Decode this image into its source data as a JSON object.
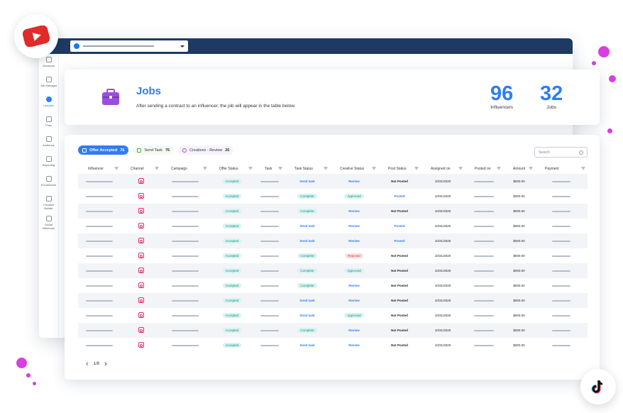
{
  "colors": {
    "accent": "#2f7df6",
    "titlebar": "#1e3a63",
    "decor_dots": "#d83ee0",
    "pill_teal": "#d6f4f1",
    "pill_red": "#fde1e1"
  },
  "badges": {
    "top_left": "youtube-logo",
    "bottom_right": "tiktok-logo"
  },
  "sidebar": {
    "items": [
      {
        "label": "Accounts",
        "icon": "person-icon"
      },
      {
        "label": "Job Manager",
        "icon": "briefcase-icon"
      },
      {
        "label": "Updates",
        "icon": "updates-icon",
        "active": true
      },
      {
        "label": "Flow",
        "icon": "flow-icon"
      },
      {
        "label": "Audience",
        "icon": "audience-icon"
      },
      {
        "label": "Reporting",
        "icon": "reporting-icon"
      },
      {
        "label": "Ecommerce",
        "icon": "cart-icon"
      },
      {
        "label": "Creative Builder",
        "icon": "builder-icon"
      },
      {
        "label": "Social Influencer",
        "icon": "influencer-icon"
      }
    ]
  },
  "header": {
    "title": "Jobs",
    "subtitle": "After sending a contract to an influencer, the job will appear in the table below.",
    "stats": [
      {
        "value": "96",
        "label": "Influencers"
      },
      {
        "value": "32",
        "label": "Jobs"
      }
    ]
  },
  "tabs": [
    {
      "label": "Offer Accepted",
      "count": "76"
    },
    {
      "label": "Send Task",
      "count": "76"
    },
    {
      "label": "Creatives - Review",
      "count": "26"
    }
  ],
  "search": {
    "placeholder": "Search"
  },
  "table": {
    "columns": [
      "Influencer",
      "Channel",
      "Campaign",
      "Offer Status",
      "Task",
      "Task Status",
      "Creative Status",
      "Post Status",
      "Assigned on",
      "Posted on",
      "Amount",
      "Payment"
    ],
    "rows": [
      {
        "offer": "Accepted",
        "task_status": "Send task",
        "creative": "Review",
        "post": "Not Posted",
        "assigned": "10/31/2020",
        "amount": "$000.00"
      },
      {
        "offer": "Accepted",
        "task_status": "Complete",
        "creative": "Approved",
        "post": "Posted",
        "assigned": "10/31/2020",
        "amount": "$000.00"
      },
      {
        "offer": "Accepted",
        "task_status": "Complete",
        "creative": "Review",
        "post": "Not Posted",
        "assigned": "10/31/2020",
        "amount": "$000.00"
      },
      {
        "offer": "Accepted",
        "task_status": "Send task",
        "creative": "Review",
        "post": "Posted",
        "assigned": "10/31/2020",
        "amount": "$000.00"
      },
      {
        "offer": "Accepted",
        "task_status": "Send task",
        "creative": "Review",
        "post": "Posted",
        "assigned": "10/31/2020",
        "amount": "$000.00"
      },
      {
        "offer": "Accepted",
        "task_status": "Complete",
        "creative": "Rejected",
        "post": "Not Posted",
        "assigned": "10/31/2020",
        "amount": "$000.00"
      },
      {
        "offer": "Accepted",
        "task_status": "Complete",
        "creative": "Approved",
        "post": "Not Posted",
        "assigned": "10/31/2020",
        "amount": "$000.00"
      },
      {
        "offer": "Accepted",
        "task_status": "Complete",
        "creative": "Review",
        "post": "Not Posted",
        "assigned": "10/31/2020",
        "amount": "$000.00"
      },
      {
        "offer": "Accepted",
        "task_status": "Send task",
        "creative": "Review",
        "post": "Not Posted",
        "assigned": "10/31/2020",
        "amount": "$000.00"
      },
      {
        "offer": "Accepted",
        "task_status": "Send task",
        "creative": "Approved",
        "post": "Not Posted",
        "assigned": "10/31/2020",
        "amount": "$000.00"
      },
      {
        "offer": "Accepted",
        "task_status": "Complete",
        "creative": "Review",
        "post": "Not Posted",
        "assigned": "10/31/2020",
        "amount": "$000.00"
      },
      {
        "offer": "Accepted",
        "task_status": "Send task",
        "creative": "Review",
        "post": "Not Posted",
        "assigned": "10/31/2020",
        "amount": "$000.00"
      }
    ]
  },
  "pagination": {
    "label": "1/8"
  }
}
